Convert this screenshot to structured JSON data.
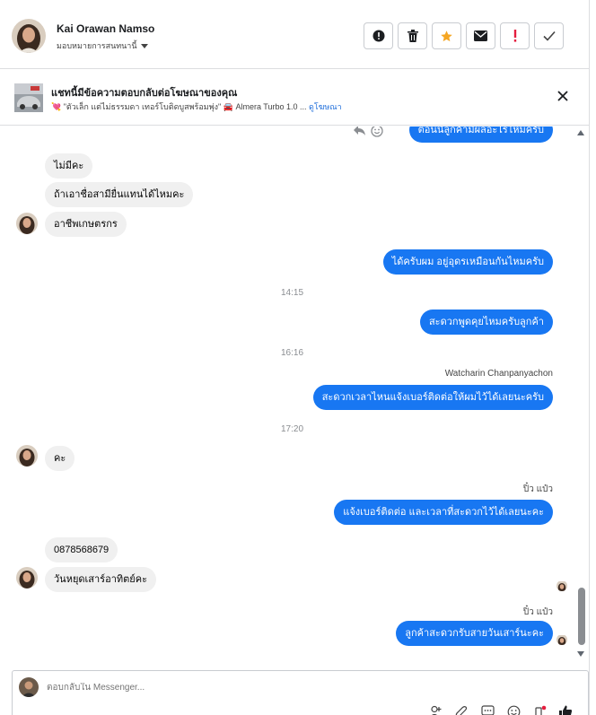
{
  "header": {
    "contact_name": "Kai Orawan Namso",
    "assign_label": "มอบหมายการสนทนานี้",
    "actions": [
      {
        "icon": "alert-icon"
      },
      {
        "icon": "trash-icon"
      },
      {
        "icon": "star-icon",
        "color": "#f5a623"
      },
      {
        "icon": "mail-icon"
      },
      {
        "icon": "exclamation-icon",
        "color": "#e41e3f"
      },
      {
        "icon": "check-icon"
      }
    ]
  },
  "ad": {
    "title": "แชทนี้มีข้อความตอบกลับต่อโฆษณาของคุณ",
    "subtitle": "💘 \"ตัวเล็ก แต่ไม่ธรรมดา เทอร์โบติดบูสพร้อมพุ่ง\" 🚘 Almera Turbo 1.0 ...",
    "link": "ดูโฆษณา"
  },
  "chat": {
    "partial_out": "ตอนนี้ลูกค้ามีผลอะไรไหมครับ",
    "msg_in_1": "ไม่มีคะ",
    "msg_in_2": "ถ้าเอาชื่อสามียื่นแทนได้ไหมคะ",
    "msg_in_3": "อาชีพเกษตรกร",
    "msg_out_1": "ได้ครับผม อยู่อุดรเหมือนกันไหมครับ",
    "time_1": "14:15",
    "msg_out_2": "สะดวกพูดคุยไหมครับลูกค้า",
    "time_2": "16:16",
    "sender_1": "Watcharin Chanpanyachon",
    "msg_out_3": "สะดวกเวลาไหนแจ้งเบอร์ติดต่อให้ผมไว้ได้เลยนะครับ",
    "time_3": "17:20",
    "msg_in_4": "คะ",
    "sender_2": "ปิ๋ว แป๋ว",
    "msg_out_4": "แจ้งเบอร์ติดต่อ  และเวลาที่สะดวกไว้ได้เลยนะคะ",
    "msg_in_5": "0878568679",
    "msg_in_6": "วันหยุดเสาร์อาทิตย์คะ",
    "sender_3": "ปิ๋ว แป๋ว",
    "msg_out_5": "ลูกค้าสะดวกรับสายวันเสาร์นะคะ"
  },
  "composer": {
    "placeholder": "ตอบกลับใน Messenger..."
  },
  "colors": {
    "outgoing": "#1877f2",
    "incoming": "#f0f0f0"
  }
}
